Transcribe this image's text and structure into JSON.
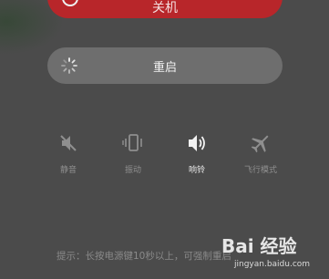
{
  "power_off": {
    "label": "关机"
  },
  "restart": {
    "label": "重启"
  },
  "modes": [
    {
      "label": "静音",
      "icon": "mute-icon",
      "active": false
    },
    {
      "label": "振动",
      "icon": "vibrate-icon",
      "active": false
    },
    {
      "label": "响铃",
      "icon": "ring-icon",
      "active": true
    },
    {
      "label": "飞行模式",
      "icon": "airplane-icon",
      "active": false
    }
  ],
  "hint": "提示：长按电源键10秒以上，可强制重启",
  "watermark": {
    "brand": "Bai 经验",
    "url": "jingyan.baidu.com"
  },
  "colors": {
    "background": "#4b4b4b",
    "power_off": "#b8262a",
    "restart": "#6e6e6e"
  }
}
